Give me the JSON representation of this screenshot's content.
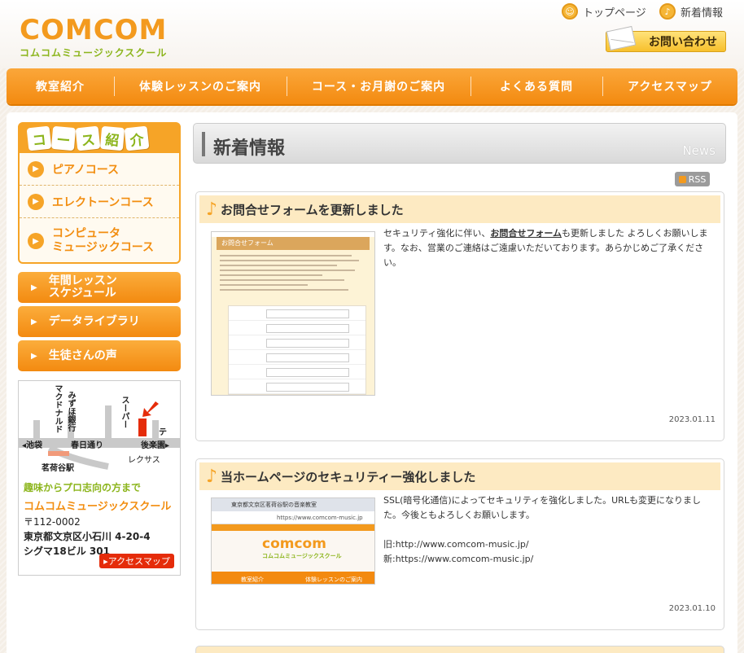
{
  "header": {
    "logo_main": "COMCOM",
    "logo_sub": "コムコムミュージックスクール",
    "links": {
      "top": "トップページ",
      "news": "新着情報"
    },
    "contact_label": "お問い合わせ"
  },
  "nav": {
    "items": [
      "教室紹介",
      "体験レッスンのご案内",
      "コース・お月謝のご案内",
      "よくある質問",
      "アクセスマップ"
    ]
  },
  "sidebar": {
    "course_title_chars": [
      "コ",
      "ー",
      "ス",
      "紹",
      "介"
    ],
    "courses": [
      "ピアノコース",
      "エレクトーンコース",
      "コンピュータ\nミュージックコース"
    ],
    "buttons": [
      "年間レッスン\nスケジュール",
      "データライブラリ",
      "生徒さんの声"
    ],
    "map": {
      "labels": {
        "mcd": "マクドナルド",
        "mizuho": "みずほ銀行",
        "super": "スーパー",
        "ikebukuro": "◂池袋",
        "kasuga": "春日通り",
        "korakuen": "後楽園▸",
        "lexus": "レクサス",
        "station": "茗荷谷駅",
        "te": "テ"
      },
      "catch": "趣味からプロ志向の方まで",
      "school": "コムコムミュージックスクール",
      "zip": "〒112-0002",
      "addr1": "東京都文京区小石川 4-20-4",
      "addr2": "シグマ18ビル 301",
      "access_btn": "▸アクセスマップ"
    }
  },
  "content": {
    "title": "新着情報",
    "title_en": "News",
    "rss": "RSS",
    "news": [
      {
        "title": "お問合せフォームを更新しました",
        "text_pre": "セキュリティ強化に伴い、",
        "text_link": "お問合せフォーム",
        "text_post": "も更新しました よろしくお願いします。なお、営業のご連絡はご遠慮いただいております。あらかじめご了承ください。",
        "image_header": "お問合せフォーム",
        "date": "2023.01.11"
      },
      {
        "title": "当ホームページのセキュリティー強化しました",
        "lines": [
          "SSL(暗号化通信)によってセキュリティを強化しました。URLも変更になりました。今後ともよろしくお願いします。",
          "",
          "旧:http://www.comcom-music.jp/",
          "新:https://www.comcom-music.jp/"
        ],
        "image_tab": "東京都文京区茗荷谷駅の音楽教室",
        "image_url": "https://www.comcom-music.jp",
        "image_logo": "comcom",
        "image_logo_sub": "コムコムミュージックスクール",
        "image_nav": [
          "教室紹介",
          "体験レッスンのご案内"
        ],
        "date": "2023.01.10"
      }
    ]
  },
  "colors": {
    "orange": "#f39a1e",
    "green": "#8cb51c",
    "news_head_bg": "#fdeac2"
  }
}
